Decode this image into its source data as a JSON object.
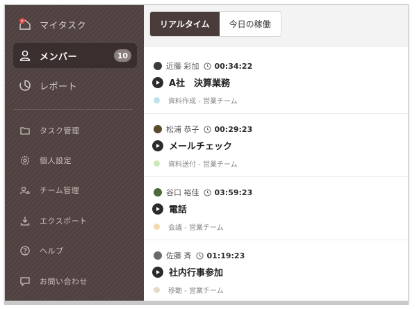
{
  "sidebar": {
    "logo_label": "マイタスク",
    "items": [
      {
        "label": "メンバー",
        "badge": "10",
        "icon": "person-icon"
      },
      {
        "label": "レポート",
        "icon": "report-icon"
      }
    ],
    "sub_items": [
      {
        "label": "タスク管理",
        "icon": "folder-icon"
      },
      {
        "label": "個人設定",
        "icon": "gear-icon"
      },
      {
        "label": "チーム管理",
        "icon": "team-icon"
      },
      {
        "label": "エクスポート",
        "icon": "download-icon"
      },
      {
        "label": "ヘルプ",
        "icon": "help-icon"
      },
      {
        "label": "お問い合わせ",
        "icon": "chat-icon"
      }
    ]
  },
  "tabs": [
    {
      "label": "リアルタイム",
      "active": true
    },
    {
      "label": "今日の稼働",
      "active": false
    }
  ],
  "members": [
    {
      "name": "近藤 彩加",
      "elapsed": "00:34:22",
      "task": "A社　決算業務",
      "category": "資料作成 - 営業チーム",
      "dot_color": "#bfe3ec",
      "avatar_color": "#3b3b3b"
    },
    {
      "name": "松浦 恭子",
      "elapsed": "00:29:23",
      "task": "メールチェック",
      "category": "資料送付 - 営業チーム",
      "dot_color": "#cfeab8",
      "avatar_color": "#5a4a2e"
    },
    {
      "name": "谷口 裕佳",
      "elapsed": "03:59:23",
      "task": "電話",
      "category": "会議 - 営業チーム",
      "dot_color": "#f5d9b0",
      "avatar_color": "#4a6a3a"
    },
    {
      "name": "佐藤 斉",
      "elapsed": "01:19:23",
      "task": "社内行事参加",
      "category": "移動 - 営業チーム",
      "dot_color": "#e6dcc6",
      "avatar_color": "#6a6a6a"
    }
  ]
}
